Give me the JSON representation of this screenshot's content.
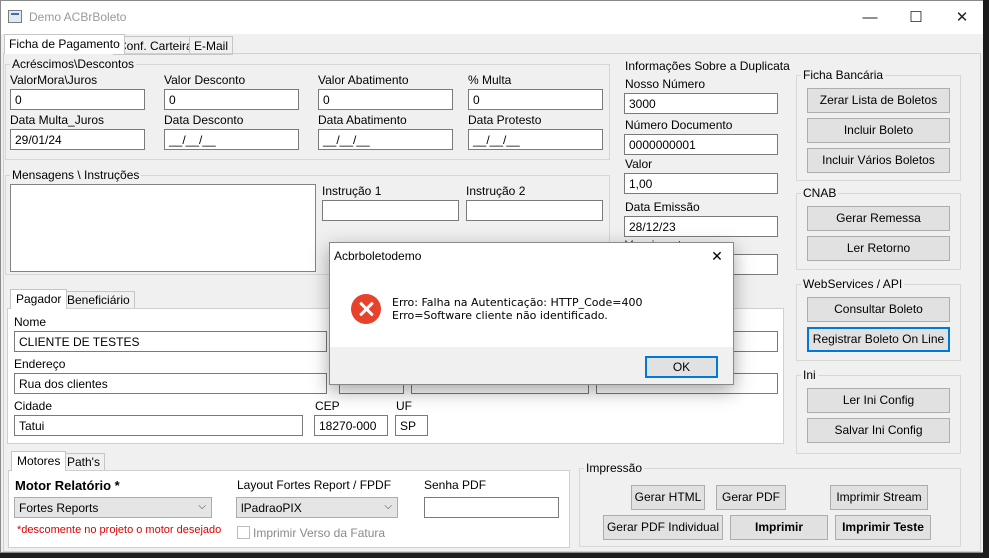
{
  "window": {
    "title": "Demo ACBrBoleto",
    "minimize": "—",
    "maximize": "☐",
    "close": "✕"
  },
  "tabs": [
    {
      "label": "Ficha de Pagamento"
    },
    {
      "label": "Conf. Carteira"
    },
    {
      "label": "E-Mail"
    }
  ],
  "acrescimos": {
    "group_label": "Acréscimos\\Descontos",
    "fields": [
      {
        "label": "ValorMora\\Juros",
        "value": "0"
      },
      {
        "label": "Valor Desconto",
        "value": "0"
      },
      {
        "label": "Valor Abatimento",
        "value": "0"
      },
      {
        "label": "% Multa",
        "value": "0"
      },
      {
        "label": "Data Multa_Juros",
        "value": "29/01/24"
      },
      {
        "label": "Data Desconto",
        "value": "__/__/__"
      },
      {
        "label": "Data Abatimento",
        "value": "__/__/__"
      },
      {
        "label": "Data Protesto",
        "value": "__/__/__"
      }
    ]
  },
  "mensagens": {
    "group_label": "Mensagens \\ Instruções",
    "instrucao1_label": "Instrução 1",
    "instrucao2_label": "Instrução 2",
    "instrucao1_value": "",
    "instrucao2_value": ""
  },
  "duplicata": {
    "group_label": "Informações Sobre a Duplicata",
    "nosso_numero_label": "Nosso Número",
    "nosso_numero": "3000",
    "numero_documento_label": "Número Documento",
    "numero_documento": "0000000001",
    "valor_label": "Valor",
    "valor": "1,00",
    "data_emissao_label": "Data Emissão",
    "data_emissao": "28/12/23",
    "vencimento_label": "Vencimento",
    "vencimento": ""
  },
  "pagador_tabs": [
    {
      "label": "Pagador"
    },
    {
      "label": "Beneficiário"
    }
  ],
  "pagador": {
    "nome_label": "Nome",
    "nome": "CLIENTE DE TESTES",
    "endereco_label": "Endereço",
    "endereco": "Rua dos clientes",
    "cidade_label": "Cidade",
    "cidade": "Tatui",
    "cep_label": "CEP",
    "cep": "18270-000",
    "uf_label": "UF",
    "uf": "SP"
  },
  "motor_tabs": [
    {
      "label": "Motores"
    },
    {
      "label": "Path's"
    }
  ],
  "motor": {
    "relatorio_label": "Motor Relatório *",
    "relatorio_value": "Fortes Reports",
    "layout_label": "Layout Fortes Report / FPDF",
    "layout_value": "lPadraoPIX",
    "senha_label": "Senha PDF",
    "senha_value": "",
    "hint": "*descomente no projeto o motor desejado",
    "imprimir_verso": "Imprimir Verso da Fatura"
  },
  "ficha_bancaria": {
    "group_label": "Ficha Bancária",
    "buttons": [
      "Zerar Lista de Boletos",
      "Incluir Boleto",
      "Incluir Vários Boletos"
    ]
  },
  "cnab": {
    "group_label": "CNAB",
    "buttons": [
      "Gerar Remessa",
      "Ler Retorno"
    ]
  },
  "webservices": {
    "group_label": "WebServices / API",
    "buttons": [
      "Consultar Boleto",
      "Registrar Boleto On Line"
    ]
  },
  "ini": {
    "group_label": "Ini",
    "buttons": [
      "Ler Ini Config",
      "Salvar Ini Config"
    ]
  },
  "impressao": {
    "group_label": "Impressão",
    "buttons": [
      "Gerar HTML",
      "Gerar PDF",
      "Imprimir Stream",
      "Gerar PDF Individual",
      "Imprimir",
      "Imprimir Teste"
    ]
  },
  "dialog": {
    "title": "Acbrboletodemo",
    "close": "✕",
    "message": "Erro: Falha na Autenticação: HTTP_Code=400 Erro=Software cliente não identificado.",
    "ok": "OK",
    "icon": "error-icon"
  },
  "colors": {
    "accent": "#0078d7",
    "error": "#e8412c",
    "hint": "#e00000"
  }
}
